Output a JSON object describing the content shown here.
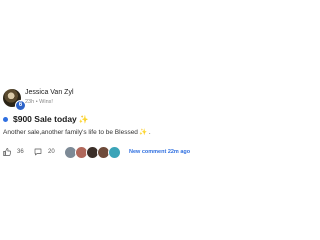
{
  "post": {
    "author": {
      "name": "Jessica Van Zyl",
      "badge": "6",
      "meta": "23h • Wins!"
    },
    "title": "$900 Sale today",
    "title_emoji": "✨",
    "body": "Another sale,another family's life to be Blessed",
    "body_emoji": "✨",
    "body_suffix": " .",
    "likes": "36",
    "comments": "20",
    "new_comment": "New comment 22m ago",
    "participants": [
      {
        "name": "participant-avatar-1",
        "color": "#7d8a96"
      },
      {
        "name": "participant-avatar-2",
        "color": "#b0675a"
      },
      {
        "name": "participant-avatar-3",
        "color": "#3b2e28"
      },
      {
        "name": "participant-avatar-4",
        "color": "#6e4a3a"
      },
      {
        "name": "participant-avatar-5",
        "color": "#3ba4b8"
      }
    ]
  },
  "colors": {
    "accent": "#2f6fe0",
    "badge": "#2d63c8"
  }
}
